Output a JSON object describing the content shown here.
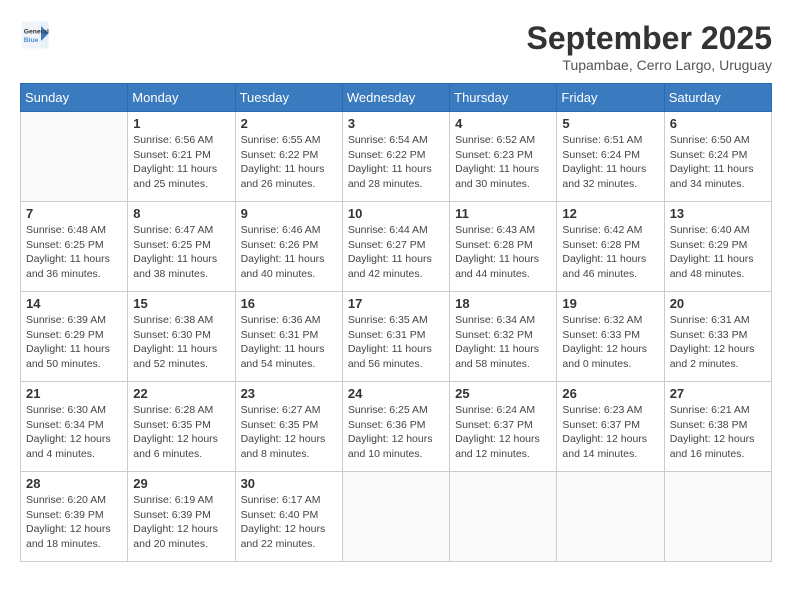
{
  "header": {
    "logo_general": "General",
    "logo_blue": "Blue",
    "month_year": "September 2025",
    "location": "Tupambae, Cerro Largo, Uruguay"
  },
  "days_of_week": [
    "Sunday",
    "Monday",
    "Tuesday",
    "Wednesday",
    "Thursday",
    "Friday",
    "Saturday"
  ],
  "weeks": [
    [
      {
        "day": "",
        "sunrise": "",
        "sunset": "",
        "daylight": ""
      },
      {
        "day": "1",
        "sunrise": "Sunrise: 6:56 AM",
        "sunset": "Sunset: 6:21 PM",
        "daylight": "Daylight: 11 hours and 25 minutes."
      },
      {
        "day": "2",
        "sunrise": "Sunrise: 6:55 AM",
        "sunset": "Sunset: 6:22 PM",
        "daylight": "Daylight: 11 hours and 26 minutes."
      },
      {
        "day": "3",
        "sunrise": "Sunrise: 6:54 AM",
        "sunset": "Sunset: 6:22 PM",
        "daylight": "Daylight: 11 hours and 28 minutes."
      },
      {
        "day": "4",
        "sunrise": "Sunrise: 6:52 AM",
        "sunset": "Sunset: 6:23 PM",
        "daylight": "Daylight: 11 hours and 30 minutes."
      },
      {
        "day": "5",
        "sunrise": "Sunrise: 6:51 AM",
        "sunset": "Sunset: 6:24 PM",
        "daylight": "Daylight: 11 hours and 32 minutes."
      },
      {
        "day": "6",
        "sunrise": "Sunrise: 6:50 AM",
        "sunset": "Sunset: 6:24 PM",
        "daylight": "Daylight: 11 hours and 34 minutes."
      }
    ],
    [
      {
        "day": "7",
        "sunrise": "Sunrise: 6:48 AM",
        "sunset": "Sunset: 6:25 PM",
        "daylight": "Daylight: 11 hours and 36 minutes."
      },
      {
        "day": "8",
        "sunrise": "Sunrise: 6:47 AM",
        "sunset": "Sunset: 6:25 PM",
        "daylight": "Daylight: 11 hours and 38 minutes."
      },
      {
        "day": "9",
        "sunrise": "Sunrise: 6:46 AM",
        "sunset": "Sunset: 6:26 PM",
        "daylight": "Daylight: 11 hours and 40 minutes."
      },
      {
        "day": "10",
        "sunrise": "Sunrise: 6:44 AM",
        "sunset": "Sunset: 6:27 PM",
        "daylight": "Daylight: 11 hours and 42 minutes."
      },
      {
        "day": "11",
        "sunrise": "Sunrise: 6:43 AM",
        "sunset": "Sunset: 6:28 PM",
        "daylight": "Daylight: 11 hours and 44 minutes."
      },
      {
        "day": "12",
        "sunrise": "Sunrise: 6:42 AM",
        "sunset": "Sunset: 6:28 PM",
        "daylight": "Daylight: 11 hours and 46 minutes."
      },
      {
        "day": "13",
        "sunrise": "Sunrise: 6:40 AM",
        "sunset": "Sunset: 6:29 PM",
        "daylight": "Daylight: 11 hours and 48 minutes."
      }
    ],
    [
      {
        "day": "14",
        "sunrise": "Sunrise: 6:39 AM",
        "sunset": "Sunset: 6:29 PM",
        "daylight": "Daylight: 11 hours and 50 minutes."
      },
      {
        "day": "15",
        "sunrise": "Sunrise: 6:38 AM",
        "sunset": "Sunset: 6:30 PM",
        "daylight": "Daylight: 11 hours and 52 minutes."
      },
      {
        "day": "16",
        "sunrise": "Sunrise: 6:36 AM",
        "sunset": "Sunset: 6:31 PM",
        "daylight": "Daylight: 11 hours and 54 minutes."
      },
      {
        "day": "17",
        "sunrise": "Sunrise: 6:35 AM",
        "sunset": "Sunset: 6:31 PM",
        "daylight": "Daylight: 11 hours and 56 minutes."
      },
      {
        "day": "18",
        "sunrise": "Sunrise: 6:34 AM",
        "sunset": "Sunset: 6:32 PM",
        "daylight": "Daylight: 11 hours and 58 minutes."
      },
      {
        "day": "19",
        "sunrise": "Sunrise: 6:32 AM",
        "sunset": "Sunset: 6:33 PM",
        "daylight": "Daylight: 12 hours and 0 minutes."
      },
      {
        "day": "20",
        "sunrise": "Sunrise: 6:31 AM",
        "sunset": "Sunset: 6:33 PM",
        "daylight": "Daylight: 12 hours and 2 minutes."
      }
    ],
    [
      {
        "day": "21",
        "sunrise": "Sunrise: 6:30 AM",
        "sunset": "Sunset: 6:34 PM",
        "daylight": "Daylight: 12 hours and 4 minutes."
      },
      {
        "day": "22",
        "sunrise": "Sunrise: 6:28 AM",
        "sunset": "Sunset: 6:35 PM",
        "daylight": "Daylight: 12 hours and 6 minutes."
      },
      {
        "day": "23",
        "sunrise": "Sunrise: 6:27 AM",
        "sunset": "Sunset: 6:35 PM",
        "daylight": "Daylight: 12 hours and 8 minutes."
      },
      {
        "day": "24",
        "sunrise": "Sunrise: 6:25 AM",
        "sunset": "Sunset: 6:36 PM",
        "daylight": "Daylight: 12 hours and 10 minutes."
      },
      {
        "day": "25",
        "sunrise": "Sunrise: 6:24 AM",
        "sunset": "Sunset: 6:37 PM",
        "daylight": "Daylight: 12 hours and 12 minutes."
      },
      {
        "day": "26",
        "sunrise": "Sunrise: 6:23 AM",
        "sunset": "Sunset: 6:37 PM",
        "daylight": "Daylight: 12 hours and 14 minutes."
      },
      {
        "day": "27",
        "sunrise": "Sunrise: 6:21 AM",
        "sunset": "Sunset: 6:38 PM",
        "daylight": "Daylight: 12 hours and 16 minutes."
      }
    ],
    [
      {
        "day": "28",
        "sunrise": "Sunrise: 6:20 AM",
        "sunset": "Sunset: 6:39 PM",
        "daylight": "Daylight: 12 hours and 18 minutes."
      },
      {
        "day": "29",
        "sunrise": "Sunrise: 6:19 AM",
        "sunset": "Sunset: 6:39 PM",
        "daylight": "Daylight: 12 hours and 20 minutes."
      },
      {
        "day": "30",
        "sunrise": "Sunrise: 6:17 AM",
        "sunset": "Sunset: 6:40 PM",
        "daylight": "Daylight: 12 hours and 22 minutes."
      },
      {
        "day": "",
        "sunrise": "",
        "sunset": "",
        "daylight": ""
      },
      {
        "day": "",
        "sunrise": "",
        "sunset": "",
        "daylight": ""
      },
      {
        "day": "",
        "sunrise": "",
        "sunset": "",
        "daylight": ""
      },
      {
        "day": "",
        "sunrise": "",
        "sunset": "",
        "daylight": ""
      }
    ]
  ]
}
